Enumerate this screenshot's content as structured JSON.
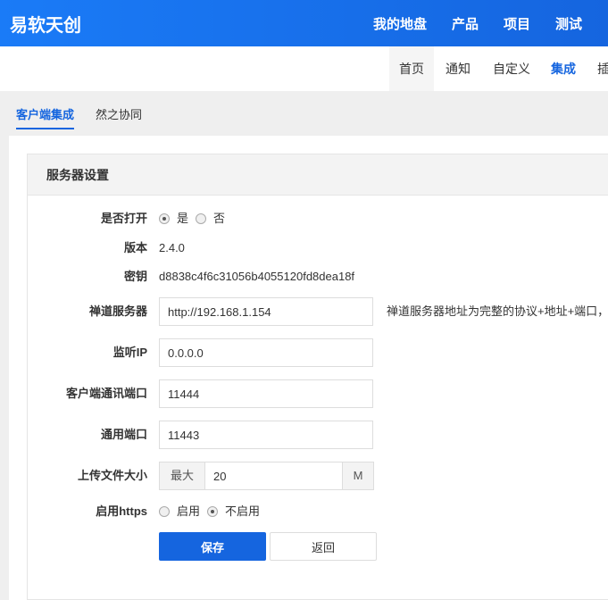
{
  "header": {
    "brand": "易软天创",
    "nav": [
      "我的地盘",
      "产品",
      "项目",
      "测试"
    ]
  },
  "subnav": {
    "items": [
      "首页",
      "通知",
      "自定义",
      "集成",
      "插"
    ]
  },
  "tabs": [
    "客户端集成",
    "然之协同"
  ],
  "section": {
    "title": "服务器设置"
  },
  "form": {
    "open": {
      "label": "是否打开",
      "options": [
        "是",
        "否"
      ],
      "selected": "是"
    },
    "version": {
      "label": "版本",
      "value": "2.4.0"
    },
    "key": {
      "label": "密钥",
      "value": "d8838c4f6c31056b4055120fd8dea18f"
    },
    "server": {
      "label": "禅道服务器",
      "value": "http://192.168.1.154",
      "hint": "禅道服务器地址为完整的协议+地址+端口，"
    },
    "ip": {
      "label": "监听IP",
      "value": "0.0.0.0"
    },
    "client_port": {
      "label": "客户端通讯端口",
      "value": "11444"
    },
    "common_port": {
      "label": "通用端口",
      "value": "11443"
    },
    "upload": {
      "label": "上传文件大小",
      "prefix": "最大",
      "value": "20",
      "suffix": "M"
    },
    "https": {
      "label": "启用https",
      "options": [
        "启用",
        "不启用"
      ],
      "selected": "不启用"
    },
    "save": "保存",
    "back": "返回"
  }
}
